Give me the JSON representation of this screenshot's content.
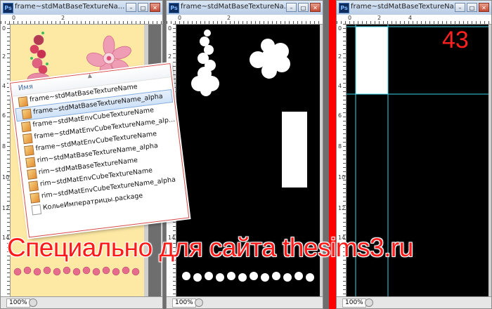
{
  "windows": [
    {
      "title": "frame~stdMatBaseTextureNa...",
      "zoom": "100%",
      "ruler_h": [
        "0",
        "2"
      ],
      "ruler_v": [
        "0",
        "2",
        "4",
        "6",
        "8",
        "10",
        "12",
        "14"
      ]
    },
    {
      "title": "frame~stdMatBaseTextureNa...",
      "zoom": "100%",
      "ruler_h": [
        "0",
        "2"
      ],
      "ruler_v": [
        "0",
        "2",
        "4",
        "6",
        "8",
        "10",
        "12",
        "14"
      ]
    },
    {
      "title": "frame~stdMatBaseTextureNa...",
      "zoom": "100%",
      "ruler_h": [
        "0",
        "2",
        "4"
      ],
      "ruler_v": [
        "0",
        "2",
        "4",
        "6",
        "8",
        "10",
        "12",
        "14"
      ]
    }
  ],
  "explorer": {
    "header": "Имя",
    "files": [
      {
        "name": "frame~stdMatBaseTextureName",
        "icon": "image-file-icon"
      },
      {
        "name": "frame~stdMatBaseTextureName_alpha",
        "icon": "image-file-icon",
        "selected": true
      },
      {
        "name": "frame~stdMatEnvCubeTextureName",
        "icon": "image-file-icon"
      },
      {
        "name": "frame~stdMatEnvCubeTextureName_alp...",
        "icon": "image-file-icon"
      },
      {
        "name": "frame~stdMatEnvCubeTextureName",
        "icon": "image-file-icon"
      },
      {
        "name": "rim~stdMatBaseTextureName_alpha",
        "icon": "image-file-icon"
      },
      {
        "name": "rim~stdMatBaseTextureName",
        "icon": "image-file-icon"
      },
      {
        "name": "rim~stdMatEnvCubeTextureName",
        "icon": "image-file-icon"
      },
      {
        "name": "rim~stdMatEnvCubeTextureName_alpha",
        "icon": "image-file-icon"
      },
      {
        "name": "КольеИмператрицы.package",
        "icon": "document-icon"
      }
    ]
  },
  "watermark": "Специально для сайта thesims3.ru",
  "badge_number": "43",
  "colors": {
    "accent_red": "#ff0000",
    "canvas_yellow": "#fde9a4",
    "guide_cyan": "#3ad6ea"
  }
}
